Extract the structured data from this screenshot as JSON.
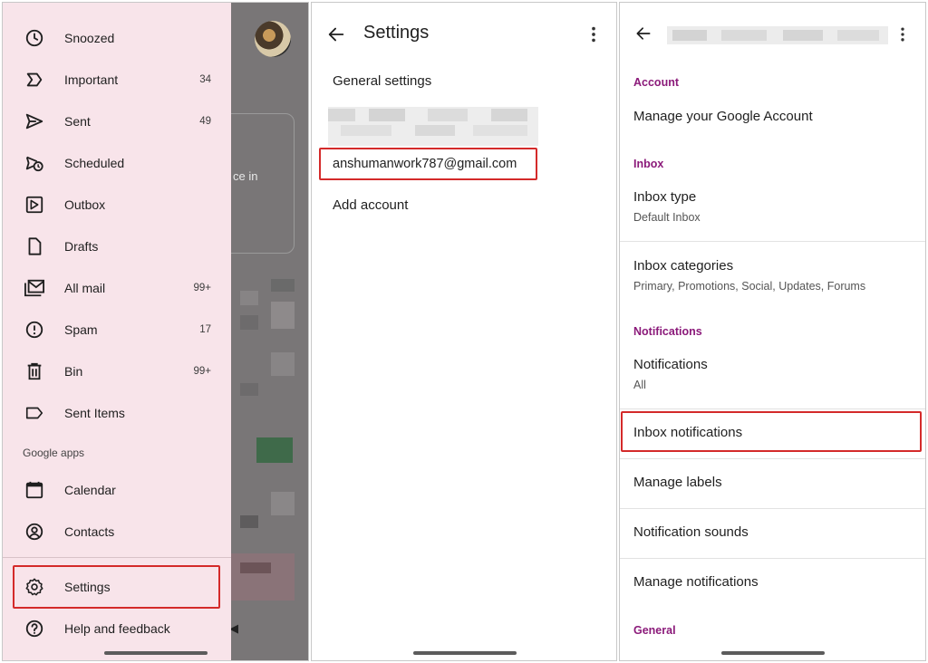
{
  "drawer": {
    "items": [
      {
        "label": "Snoozed",
        "count": "",
        "icon": "clock-icon"
      },
      {
        "label": "Important",
        "count": "34",
        "icon": "important-icon"
      },
      {
        "label": "Sent",
        "count": "49",
        "icon": "send-icon"
      },
      {
        "label": "Scheduled",
        "count": "",
        "icon": "scheduled-send-icon"
      },
      {
        "label": "Outbox",
        "count": "",
        "icon": "outbox-icon"
      },
      {
        "label": "Drafts",
        "count": "",
        "icon": "draft-icon"
      },
      {
        "label": "All mail",
        "count": "99+",
        "icon": "all-mail-icon"
      },
      {
        "label": "Spam",
        "count": "17",
        "icon": "spam-icon"
      },
      {
        "label": "Bin",
        "count": "99+",
        "icon": "trash-icon"
      },
      {
        "label": "Sent Items",
        "count": "",
        "icon": "label-icon"
      }
    ],
    "google_apps_heading": "Google apps",
    "apps": [
      {
        "label": "Calendar",
        "icon": "calendar-icon"
      },
      {
        "label": "Contacts",
        "icon": "contacts-icon"
      }
    ],
    "settings_label": "Settings",
    "help_label": "Help and feedback",
    "background_partial_text": "ce in"
  },
  "settings_screen": {
    "title": "Settings",
    "general_settings": "General settings",
    "account_email": "anshumanwork787@gmail.com",
    "add_account": "Add account"
  },
  "account_settings": {
    "sections": {
      "account": "Account",
      "inbox": "Inbox",
      "notifications": "Notifications",
      "general": "General"
    },
    "manage_account": "Manage your Google Account",
    "inbox_type": {
      "title": "Inbox type",
      "value": "Default Inbox"
    },
    "inbox_categories": {
      "title": "Inbox categories",
      "value": "Primary, Promotions, Social, Updates, Forums"
    },
    "notifications": {
      "title": "Notifications",
      "value": "All"
    },
    "inbox_notifications": "Inbox notifications",
    "manage_labels": "Manage labels",
    "notification_sounds": "Notification sounds",
    "manage_notifications": "Manage notifications"
  },
  "colors": {
    "drawer_bg": "#f8e4ea",
    "highlight_red": "#d42a2a",
    "section_purple": "#8b1a7a"
  }
}
